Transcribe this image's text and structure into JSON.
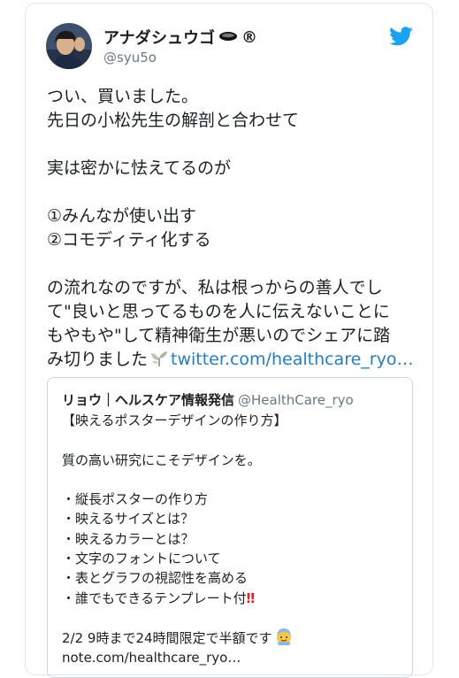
{
  "author": {
    "display_name": "アナダシュウゴ",
    "badge": "®",
    "handle": "@syu5o"
  },
  "tweet": {
    "lines": [
      "つい、買いました。",
      "先日の小松先生の解剖と合わせて",
      "",
      "実は密かに怯えてるのが",
      "",
      "①みんなが使い出す",
      "②コモディティ化する",
      "",
      "の流れなのですが、私は根っからの善人でし",
      "て\"良いと思ってるものを人に伝えないことに",
      "もやもや\"して精神衛生が悪いのでシェアに踏"
    ],
    "last_line_text": "み切りました",
    "link_text": "twitter.com/healthcare_ryo…"
  },
  "quoted": {
    "name": "リョウ｜ヘルスケア情報発信",
    "handle": "@HealthCare_ryo",
    "lines": [
      "【映えるポスターデザインの作り方】",
      "",
      "質の高い研究にこそデザインを。",
      "",
      "・縦長ポスターの作り方",
      "・映えるサイズとは？",
      "・映えるカラーとは？",
      "・文字のフォントについて",
      "・表とグラフの視認性を高める"
    ],
    "template_line": "・誰でもできるテンプレート付",
    "template_mark": "‼",
    "sale_line": "2/2  9時まで24時間限定で半額です",
    "url_line": "note.com/healthcare_ryo…"
  },
  "icons": [
    "twitter-bird-icon",
    "glasses-icon",
    "plant-icon",
    "face-emoji-icon"
  ],
  "colors": {
    "link": "#2b7bb9",
    "twitter_blue": "#1da1f2",
    "secondary_text": "#697882",
    "border": "#e1e8ed"
  }
}
